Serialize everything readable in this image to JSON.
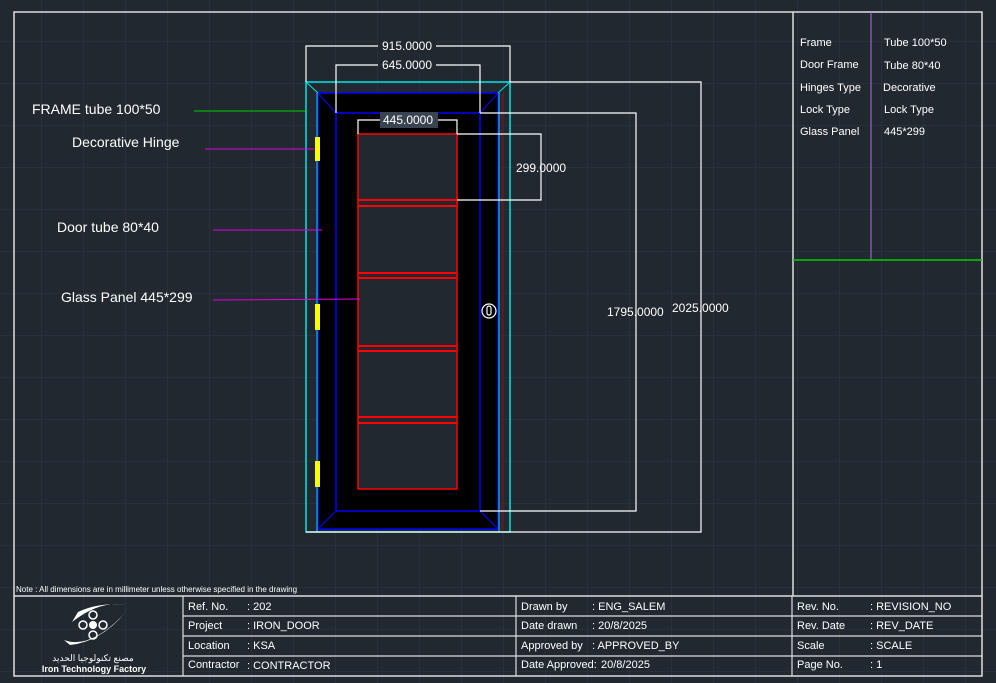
{
  "drawing": {
    "dimensions": {
      "overall_width": "915.0000",
      "door_width": "645.0000",
      "glass_width": "445.0000",
      "glass_height": "299.0000",
      "door_height": "1795.0000",
      "overall_height": "2025.0000"
    },
    "callouts": [
      "FRAME tube 100*50",
      "Decorative Hinge",
      "Door tube 80*40",
      "Glass Panel 445*299"
    ],
    "colors": {
      "frame": "#00e5e5",
      "door": "#0000ff",
      "glass": "#ff0000",
      "hinge": "#ffff00",
      "leader": "#e000e0",
      "background": "#212830"
    }
  },
  "spec_table": [
    {
      "label": "Frame",
      "value": "Tube 100*50"
    },
    {
      "label": "Door Frame",
      "value": "Tube 80*40"
    },
    {
      "label": "Hinges Type",
      "value": "Decorative"
    },
    {
      "label": "Lock Type",
      "value": "Lock Type"
    },
    {
      "label": "Glass Panel",
      "value": "445*299"
    }
  ],
  "note": "Note : All dimensions are in millimeter unless otherwise specified in the drawing",
  "logo": {
    "arabic": "مصنع تكنولوجيا الحديد",
    "english": "Iron Technology Factory"
  },
  "title_block": {
    "col1": [
      {
        "label": "Ref. No.",
        "value": ": 202"
      },
      {
        "label": "Project",
        "value": ": IRON_DOOR"
      },
      {
        "label": "Location",
        "value": ": KSA"
      },
      {
        "label": "Contractor",
        "value": ": CONTRACTOR"
      }
    ],
    "col2": [
      {
        "label": "Drawn by",
        "value": ": ENG_SALEM"
      },
      {
        "label": "Date drawn",
        "value": ": 20/8/2025"
      },
      {
        "label": "Approved by",
        "value": ": APPROVED_BY"
      },
      {
        "label": "Date Approved:",
        "value": "20/8/2025"
      }
    ],
    "col3": [
      {
        "label": "Rev. No.",
        "value": ": REVISION_NO"
      },
      {
        "label": "Rev. Date",
        "value": ": REV_DATE"
      },
      {
        "label": "Scale",
        "value": ": SCALE"
      },
      {
        "label": "Page No.",
        "value": ": 1"
      }
    ]
  }
}
